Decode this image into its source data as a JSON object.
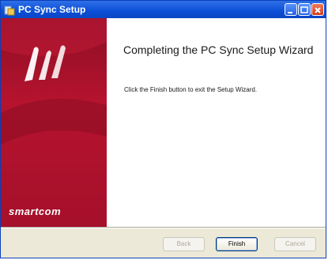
{
  "window": {
    "title": "PC Sync Setup",
    "icon": "setup-app-icon",
    "controls": [
      "minimize-icon",
      "maximize-icon",
      "close-icon"
    ]
  },
  "side_panel": {
    "brand": "smartcom",
    "logo": "smartcom-logo-icon"
  },
  "main": {
    "heading": "Completing the PC Sync Setup Wizard",
    "description": "Click the Finish button to exit the Setup Wizard."
  },
  "buttons": {
    "back_label": "Back",
    "finish_label": "Finish",
    "cancel_label": "Cancel"
  },
  "colors": {
    "title_bar": "#0b4fd6",
    "side_panel": "#b6132e",
    "dialog_face": "#ece9d8"
  }
}
